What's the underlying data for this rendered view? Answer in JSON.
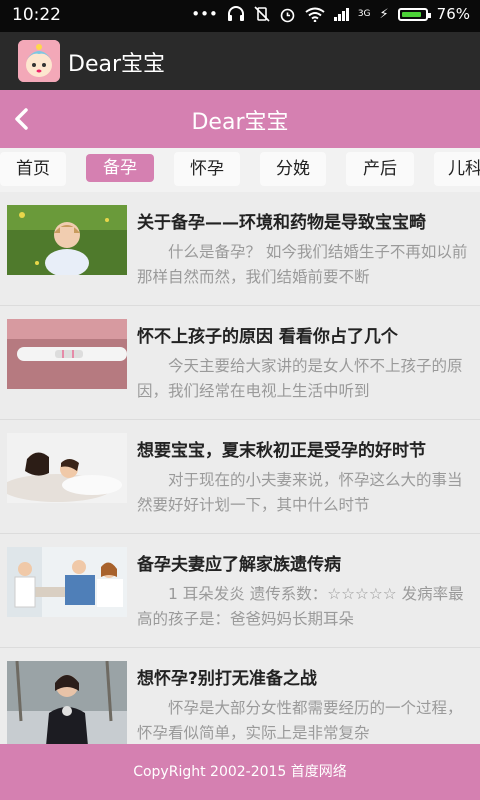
{
  "status_bar": {
    "time": "10:22",
    "network": "3G",
    "battery": "76%"
  },
  "app_bar": {
    "title": "Dear宝宝"
  },
  "header": {
    "title": "Dear宝宝",
    "back_icon": "chevron-left-icon"
  },
  "tabs": [
    {
      "label": "首页",
      "active": false
    },
    {
      "label": "备孕",
      "active": true
    },
    {
      "label": "怀孕",
      "active": false
    },
    {
      "label": "分娩",
      "active": false
    },
    {
      "label": "产后",
      "active": false
    },
    {
      "label": "儿科",
      "active": false
    }
  ],
  "articles": [
    {
      "title": "关于备孕——环境和药物是导致宝宝畸",
      "summary": "什么是备孕？ 如今我们结婚生子不再如以前那样自然而然，我们结婚前要不断"
    },
    {
      "title": "怀不上孩子的原因 看看你占了几个",
      "summary": "今天主要给大家讲的是女人怀不上孩子的原因，我们经常在电视上生活中听到"
    },
    {
      "title": "想要宝宝，夏末秋初正是受孕的好时节",
      "summary": "对于现在的小夫妻来说，怀孕这么大的事当然要好好计划一下，其中什么时节"
    },
    {
      "title": "备孕夫妻应了解家族遗传病",
      "summary": "1 耳朵发炎 遗传系数：☆☆☆☆☆ 发病率最高的孩子是：爸爸妈妈长期耳朵"
    },
    {
      "title": "想怀孕?别打无准备之战",
      "summary": "怀孕是大部分女性都需要经历的一个过程，怀孕看似简单，实际上是非常复杂"
    }
  ],
  "footer": {
    "copyright": "CopyRight 2002-2015 首度网络"
  },
  "colors": {
    "accent": "#d580b1",
    "app_bar": "#2a2a2a",
    "status_bar": "#0a0a0a"
  }
}
